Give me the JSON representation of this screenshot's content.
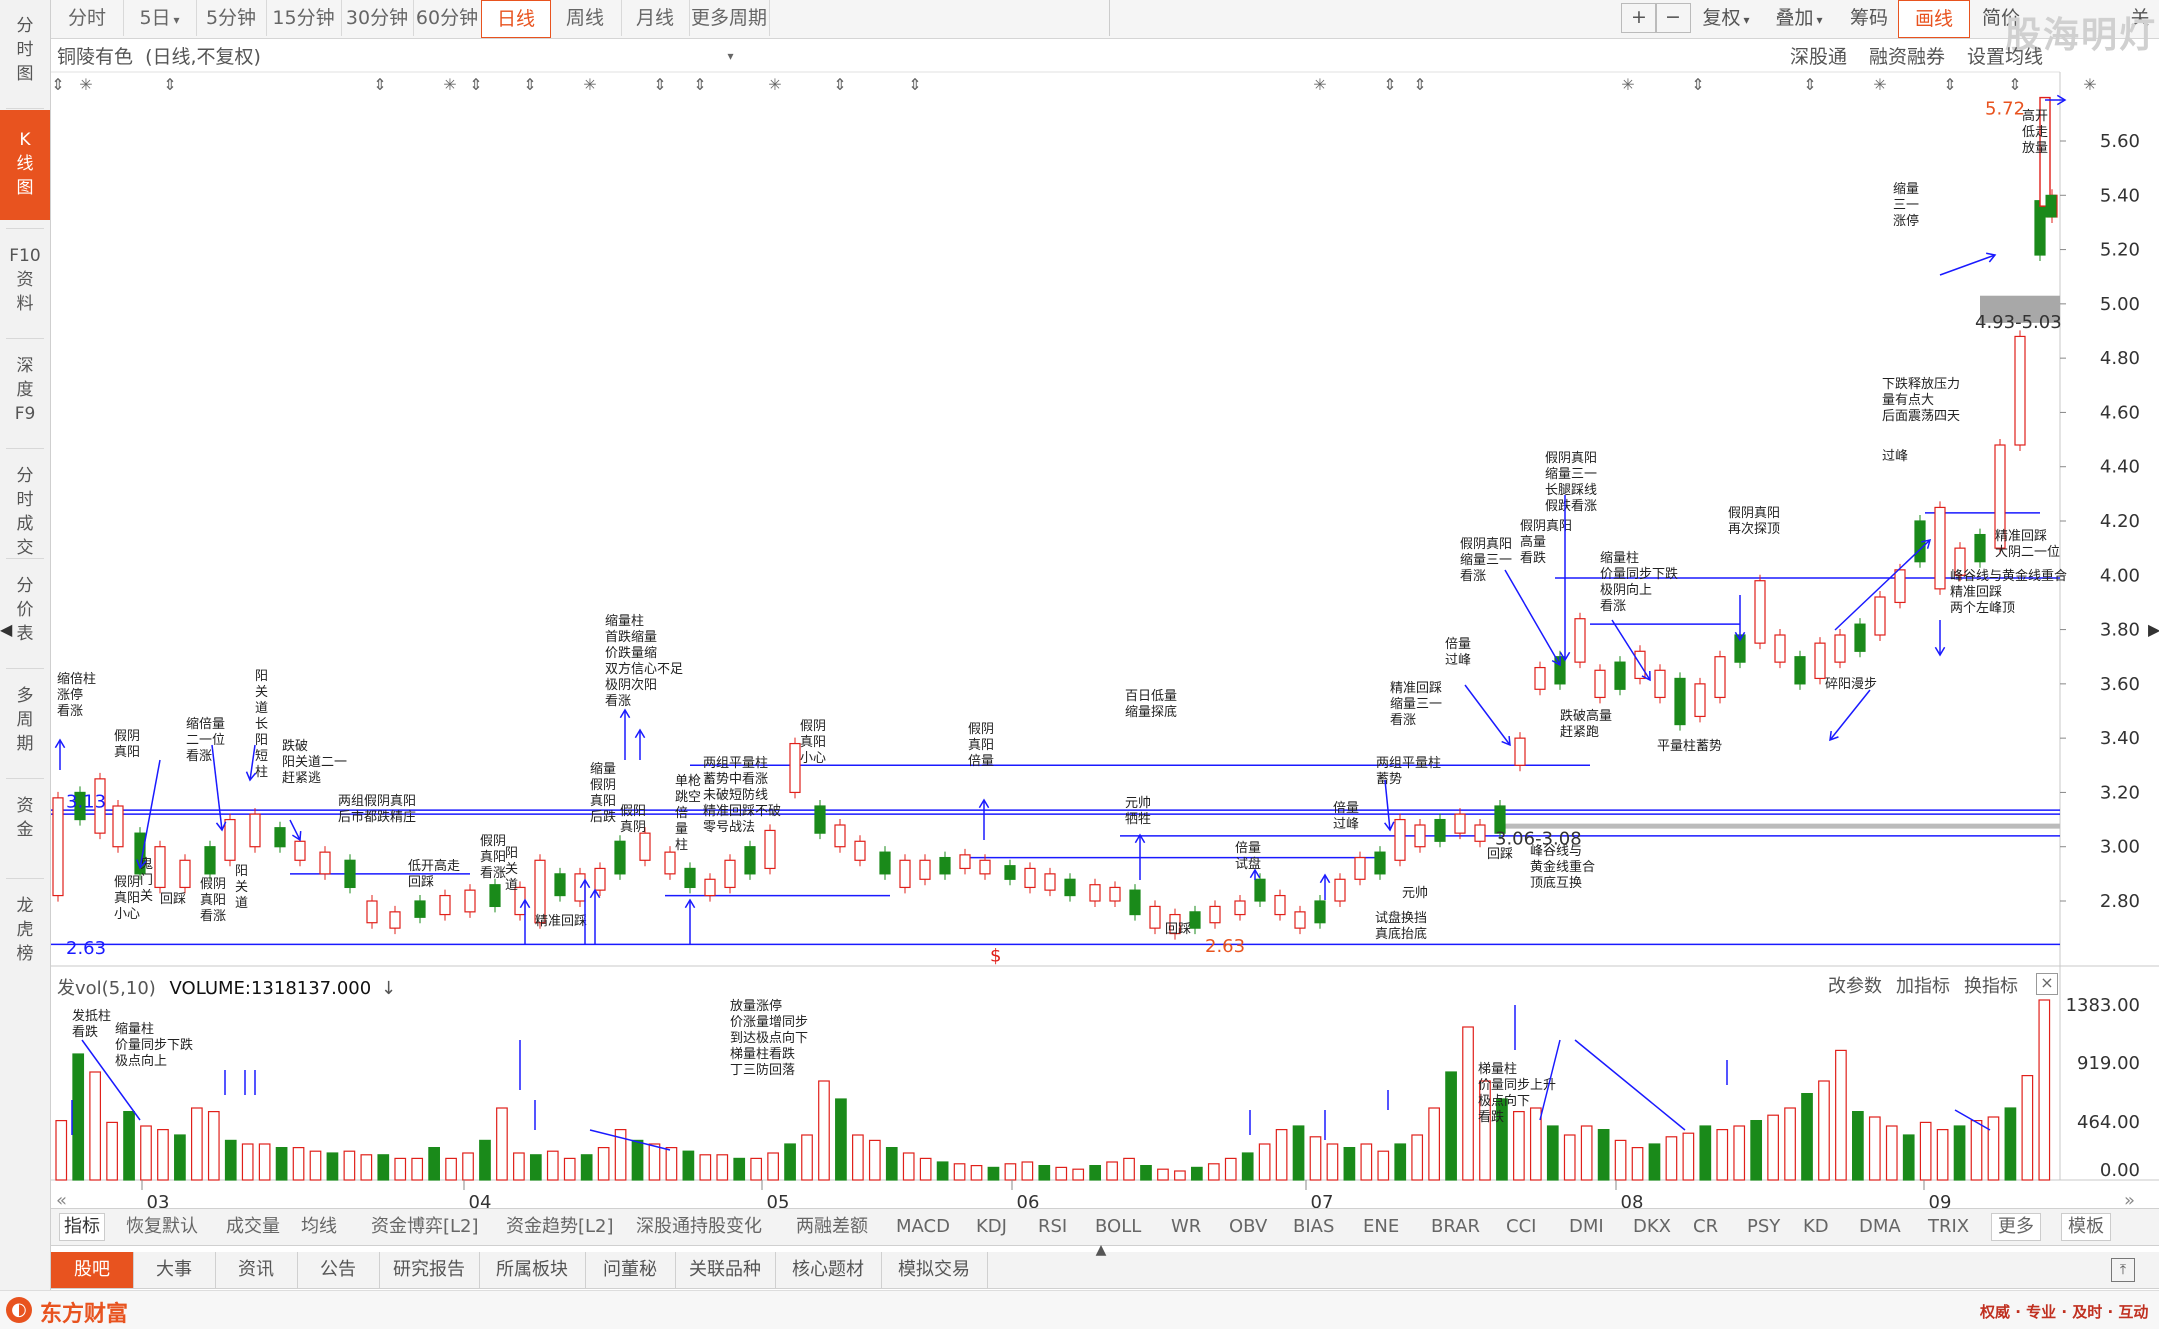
{
  "sidebar": {
    "items": [
      "分时图",
      "K线图",
      "F10资料",
      "深度F9",
      "分时成交",
      "分价表",
      "多周期",
      "资金",
      "龙虎榜"
    ]
  },
  "periods": [
    "分时",
    "5日",
    "5分钟",
    "15分钟",
    "30分钟",
    "60分钟",
    "日线",
    "周线",
    "月线",
    "更多周期"
  ],
  "active_period": "日线",
  "toolbar_right": {
    "plus": "+",
    "minus": "−",
    "fuquan": "复权",
    "diejia": "叠加",
    "chouma": "筹码",
    "huaxian": "画线",
    "jianjie": "简价",
    "close": "关"
  },
  "watermark": "股海明灯",
  "chart_header": {
    "stock": "铜陵有色",
    "mode": "(日线,不复权)",
    "links": [
      "深股通",
      "融资融券",
      "设置均线"
    ]
  },
  "price_axis": [
    "5.60",
    "5.40",
    "5.20",
    "5.00",
    "4.80",
    "4.60",
    "4.40",
    "4.20",
    "4.00",
    "3.80",
    "3.60",
    "3.40",
    "3.20",
    "3.00",
    "2.80"
  ],
  "price_markers": {
    "high": "5.72",
    "gap": "4.93-5.03",
    "mid_gap": "3.06-3.08",
    "low1": "2.63",
    "low2": "2.63",
    "left": "3.13"
  },
  "annotations": [
    {
      "t": "缩倍柱\n涨停\n看涨"
    },
    {
      "t": "假阴\n真阳"
    },
    {
      "t": "缩倍量\n二一位\n看涨"
    },
    {
      "t": "阳\n关\n道\n长\n阳\n短\n柱"
    },
    {
      "t": "跌破\n阳关道二一\n赶紧逃"
    },
    {
      "t": "两组假阴真阳\n后市都跌精庄"
    },
    {
      "t": "假阴\n真阳\n小心"
    },
    {
      "t": "鬼\n门\n关"
    },
    {
      "t": "回踩"
    },
    {
      "t": "假阴\n真阳\n看涨"
    },
    {
      "t": "阳\n关\n道"
    },
    {
      "t": "低开高走\n回踩"
    },
    {
      "t": "假阴\n真阳\n看涨"
    },
    {
      "t": "阳\n关\n道"
    },
    {
      "t": "精准回踩"
    },
    {
      "t": "缩量柱\n首跌缩量\n价跌量缩\n双方信心不足\n极阴次阳\n看涨"
    },
    {
      "t": "缩量\n假阴\n真阳\n后跌"
    },
    {
      "t": "假阳\n真阴"
    },
    {
      "t": "单枪\n跳空\n倍\n量\n柱"
    },
    {
      "t": "两组平量柱\n蓄势中看涨\n未破短防线\n精准回踩不破\n零号战法"
    },
    {
      "t": "假阴\n真阳\n小心"
    },
    {
      "t": "假阴\n真阳\n倍量"
    },
    {
      "t": "百日低量\n缩量探底"
    },
    {
      "t": "元帅\n牺牲"
    },
    {
      "t": "回踩"
    },
    {
      "t": "倍量\n试盘"
    },
    {
      "t": "倍量\n过峰"
    },
    {
      "t": "两组平量柱\n蓄势"
    },
    {
      "t": "精准回踩\n缩量三一\n看涨"
    },
    {
      "t": "元帅"
    },
    {
      "t": "试盘换挡\n真底抬底"
    },
    {
      "t": "倍量\n过峰"
    },
    {
      "t": "假阴真阳\n缩量三一\n看涨"
    },
    {
      "t": "假阴真阳\n高量\n看跌"
    },
    {
      "t": "假阴真阳\n缩量三一\n长腿踩线\n假跌看涨"
    },
    {
      "t": "跌破高量\n赶紧跑"
    },
    {
      "t": "回踩"
    },
    {
      "t": "峰谷线与\n黄金线重合\n顶底互换"
    },
    {
      "t": "缩量柱\n价量同步下跌\n极阴向上\n看涨"
    },
    {
      "t": "平量柱蓄势"
    },
    {
      "t": "假阴真阳\n再次探顶"
    },
    {
      "t": "碎阳漫步"
    },
    {
      "t": "过峰"
    },
    {
      "t": "下跌释放压力\n量有点大\n后面震荡四天"
    },
    {
      "t": "精准回踩\n大阴二一位"
    },
    {
      "t": "峰谷线与黄金线重合\n精准回踩\n两个左峰顶"
    },
    {
      "t": "缩量\n三一\n涨停"
    },
    {
      "t": "高开\n低走\n放量"
    }
  ],
  "volume": {
    "title": "发vol(5,10)",
    "value": "VOLUME:1318137.000",
    "actions": [
      "改参数",
      "加指标",
      "换指标"
    ],
    "axis": [
      "1383.00",
      "919.00",
      "464.00",
      "0.00"
    ],
    "notes": [
      {
        "t": "发抵柱\n看跌"
      },
      {
        "t": "缩量柱\n价量同步下跌\n极点向上"
      },
      {
        "t": "放量涨停\n价涨量增同步\n到达极点向下\n梯量柱看跌\n丁三防回落"
      },
      {
        "t": "梯量柱\n价量同步上升\n极点向下\n看跌"
      }
    ]
  },
  "months": [
    "03",
    "04",
    "05",
    "06",
    "07",
    "08",
    "09"
  ],
  "indicator_tabs": [
    "指标",
    "恢复默认",
    "成交量",
    "均线",
    "资金博弈[L2]",
    "资金趋势[L2]",
    "深股通持股变化",
    "两融差额",
    "MACD",
    "KDJ",
    "RSI",
    "BOLL",
    "WR",
    "OBV",
    "BIAS",
    "ENE",
    "BRAR",
    "CCI",
    "DMI",
    "DKX",
    "CR",
    "PSY",
    "KD",
    "DMA",
    "TRIX",
    "更多",
    "模板"
  ],
  "bottom_tabs": [
    "股吧",
    "大事",
    "资讯",
    "公告",
    "研究报告",
    "所属板块",
    "问董秘",
    "关联品种",
    "核心题材",
    "模拟交易"
  ],
  "footer": {
    "brand": "东方财富",
    "slogan": "权威 · 专业 · 及时 · 互动"
  },
  "colors": {
    "accent": "#e8531f",
    "up": "#e0201a",
    "down": "#1a8a1a",
    "line": "#1a1aff"
  }
}
